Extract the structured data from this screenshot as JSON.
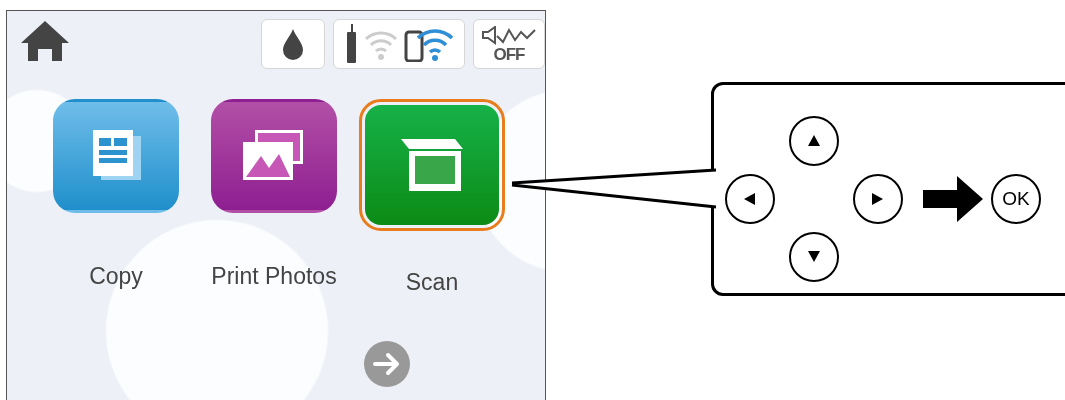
{
  "screen": {
    "sound_status": "OFF",
    "apps": [
      {
        "kind": "copy",
        "label": "Copy",
        "selected": false
      },
      {
        "kind": "photos",
        "label": "Print Photos",
        "selected": false
      },
      {
        "kind": "scan",
        "label": "Scan",
        "selected": true
      }
    ]
  },
  "control_panel": {
    "buttons": [
      {
        "kind": "up"
      },
      {
        "kind": "left"
      },
      {
        "kind": "right"
      },
      {
        "kind": "down"
      },
      {
        "kind": "ok",
        "label": "OK"
      }
    ]
  }
}
